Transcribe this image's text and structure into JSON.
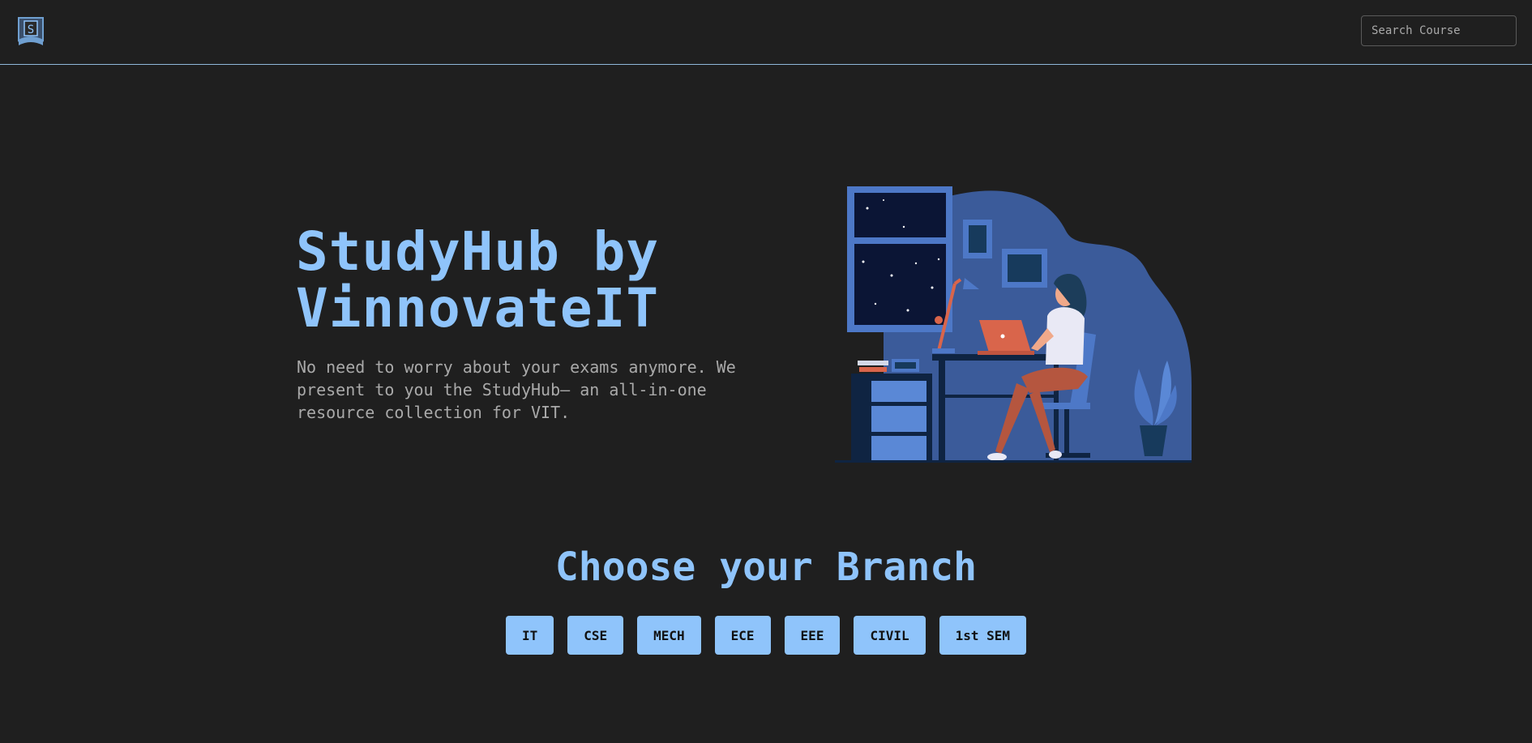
{
  "header": {
    "logo_letter": "S",
    "search_placeholder": "Search Course"
  },
  "hero": {
    "title_line1": "StudyHub by",
    "title_line2": "VinnovateIT",
    "subtitle": "No need to worry about your exams anymore. We present to you the StudyHub— an all-in-one resource collection for VIT."
  },
  "branches": {
    "title": "Choose your Branch",
    "items": [
      "IT",
      "CSE",
      "MECH",
      "ECE",
      "EEE",
      "CIVIL",
      "1st SEM"
    ]
  },
  "colors": {
    "background": "#1f1f1f",
    "accent": "#8fc4fb",
    "muted_text": "#a9a9a9",
    "divider": "#8fb7d9"
  }
}
